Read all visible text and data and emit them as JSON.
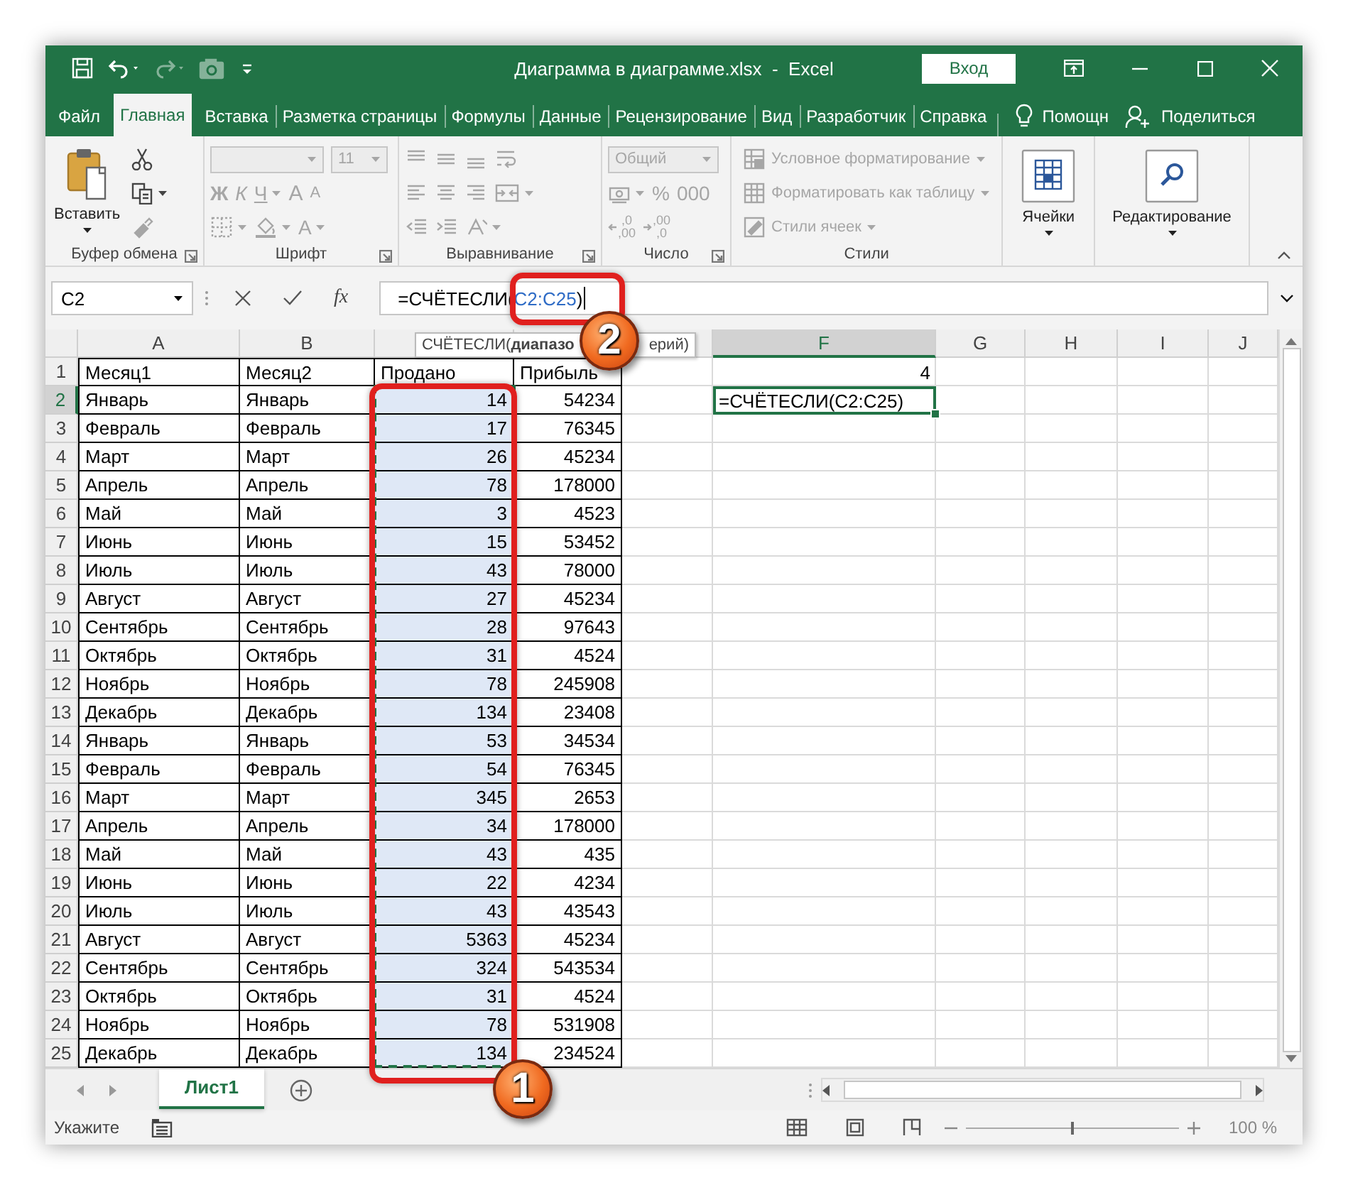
{
  "title_bar": {
    "quick_access": [
      {
        "disabled": false
      },
      {
        "disabled": false
      },
      {
        "disabled": true
      },
      {
        "disabled": true
      },
      {
        "disabled": false
      }
    ],
    "title": "Диаграмма в диаграмме.xlsx  -  Excel",
    "sign_in": "Вход"
  },
  "tabs": [
    {
      "label": "Файл",
      "selected": false
    },
    {
      "label": "Главная",
      "selected": true
    },
    {
      "label": "Вставка",
      "selected": false
    },
    {
      "label": "Разметка страницы",
      "selected": false
    },
    {
      "label": "Формулы",
      "selected": false
    },
    {
      "label": "Данные",
      "selected": false
    },
    {
      "label": "Рецензирование",
      "selected": false
    },
    {
      "label": "Вид",
      "selected": false
    },
    {
      "label": "Разработчик",
      "selected": false
    },
    {
      "label": "Справка",
      "selected": false
    }
  ],
  "help": "Помощн",
  "share": "Поделиться",
  "ribbon": {
    "groups": [
      {
        "label": "Буфер обмена",
        "launcher": true,
        "big": {
          "label": "Вставить",
          "disabled": false,
          "dropdown": true
        },
        "rows": [
          [
            {
              "kind": "icon",
              "disabled": false,
              "dropdown": false
            }
          ],
          [
            {
              "kind": "icon",
              "disabled": false,
              "dropdown": true
            }
          ],
          [
            {
              "kind": "icon",
              "disabled": true,
              "dropdown": false
            }
          ]
        ]
      },
      {
        "label": "Шрифт",
        "launcher": true,
        "rows": [
          [
            {
              "kind": "field",
              "disabled": true,
              "dropdown": true
            },
            {
              "kind": "field",
              "value": "11",
              "disabled": true,
              "dropdown": true
            }
          ],
          [
            {
              "kind": "glyph",
              "text": "Ж",
              "disabled": true,
              "dropdown": false
            },
            {
              "kind": "glyph",
              "text": "К",
              "disabled": true,
              "dropdown": false
            },
            {
              "kind": "glyph",
              "text": "Ч",
              "disabled": true,
              "dropdown": true
            },
            {
              "kind": "glyph",
              "text": "A",
              "disabled": true,
              "dropdown": false
            },
            {
              "kind": "glyph",
              "text": "A",
              "disabled": true,
              "dropdown": false
            }
          ],
          [
            {
              "kind": "icon",
              "disabled": true,
              "dropdown": true
            },
            {
              "kind": "icon",
              "disabled": true,
              "dropdown": true
            },
            {
              "kind": "glyph",
              "text": "A",
              "disabled": true,
              "dropdown": true
            }
          ]
        ]
      },
      {
        "label": "Выравнивание",
        "launcher": true,
        "rows": [
          [
            {
              "kind": "icon",
              "disabled": true,
              "dropdown": false
            },
            {
              "kind": "icon",
              "disabled": true,
              "dropdown": false
            },
            {
              "kind": "icon",
              "disabled": true,
              "dropdown": false
            },
            {
              "kind": "icon",
              "disabled": true,
              "dropdown": false
            }
          ],
          [
            {
              "kind": "icon",
              "disabled": true,
              "dropdown": false
            },
            {
              "kind": "icon",
              "disabled": true,
              "dropdown": false
            },
            {
              "kind": "icon",
              "disabled": true,
              "dropdown": false
            },
            {
              "kind": "icon",
              "disabled": true,
              "dropdown": true
            }
          ],
          [
            {
              "kind": "icon",
              "disabled": true,
              "dropdown": false
            },
            {
              "kind": "icon",
              "disabled": true,
              "dropdown": false
            },
            {
              "kind": "icon",
              "disabled": true,
              "dropdown": true
            }
          ]
        ]
      },
      {
        "label": "Число",
        "launcher": true,
        "rows": [
          [
            {
              "kind": "field",
              "value": "Общий",
              "disabled": true,
              "dropdown": true
            }
          ],
          [
            {
              "kind": "icon",
              "disabled": true,
              "dropdown": true
            },
            {
              "kind": "glyph",
              "text": "%",
              "disabled": true,
              "dropdown": false
            },
            {
              "kind": "glyph",
              "text": "000",
              "disabled": true,
              "dropdown": false
            }
          ],
          [
            {
              "kind": "decimal",
              "top": ",0",
              "bottom": ",00",
              "disabled": true
            },
            {
              "kind": "decimal",
              "top": ",00",
              "bottom": ",0",
              "disabled": true
            }
          ]
        ]
      },
      {
        "label": "Стили",
        "launcher": false,
        "rows": [
          [
            {
              "kind": "style",
              "text": "Условное форматирование",
              "disabled": true,
              "dropdown": true
            }
          ],
          [
            {
              "kind": "style",
              "text": "Форматировать как таблицу",
              "disabled": true,
              "dropdown": true
            }
          ],
          [
            {
              "kind": "style",
              "text": "Стили ячеек",
              "disabled": true,
              "dropdown": true
            }
          ]
        ]
      },
      {
        "launcher": false,
        "big": {
          "label": "Ячейки",
          "disabled": false,
          "dropdown": true
        }
      },
      {
        "launcher": false,
        "big": {
          "label": "Редактирование",
          "disabled": false,
          "dropdown": true
        }
      }
    ]
  },
  "formula_bar": {
    "name_box": "C2",
    "formula_start": "=СЧЁТЕСЛИ(",
    "formula_reference": "C2:C25",
    "formula_end": ")",
    "function_button": "fx"
  },
  "tooltip": {
    "start": "СЧЁТЕСЛИ(**диапазо**",
    "end": "ерий)"
  },
  "sheet": {
    "columns": [
      {
        "label": "A",
        "selected": false
      },
      {
        "label": "B",
        "selected": false
      },
      {
        "selected": false
      },
      {
        "selected": false
      },
      {
        "selected": false
      },
      {
        "label": "F",
        "selected": true
      },
      {
        "label": "G",
        "selected": false
      },
      {
        "label": "H",
        "selected": false
      },
      {
        "label": "I",
        "selected": false
      },
      {
        "label": "J",
        "selected": false
      }
    ],
    "rows": [
      {
        "number": "1",
        "selected": false,
        "kind": "heading",
        "range_marked": false,
        "cells": [
          "Месяц1",
          "Месяц2",
          "Продано",
          "Прибыль"
        ],
        "column_f": {
          "kind": "number",
          "text": "4",
          "active": false
        }
      },
      {
        "number": "2",
        "selected": true,
        "kind": "data",
        "range_marked": true,
        "cells": [
          "Январь",
          "Январь",
          "14",
          "54234"
        ],
        "column_f": {
          "kind": "formula",
          "text": "=СЧЁТЕСЛИ(C2:C25)",
          "active": true
        }
      },
      {
        "number": "3",
        "selected": false,
        "kind": "data",
        "range_marked": true,
        "cells": [
          "Февраль",
          "Февраль",
          "17",
          "76345"
        ]
      },
      {
        "number": "4",
        "selected": false,
        "kind": "data",
        "range_marked": true,
        "cells": [
          "Март",
          "Март",
          "26",
          "45234"
        ]
      },
      {
        "number": "5",
        "selected": false,
        "kind": "data",
        "range_marked": true,
        "cells": [
          "Апрель",
          "Апрель",
          "78",
          "178000"
        ]
      },
      {
        "number": "6",
        "selected": false,
        "kind": "data",
        "range_marked": true,
        "cells": [
          "Май",
          "Май",
          "3",
          "4523"
        ]
      },
      {
        "number": "7",
        "selected": false,
        "kind": "data",
        "range_marked": true,
        "cells": [
          "Июнь",
          "Июнь",
          "15",
          "53452"
        ]
      },
      {
        "number": "8",
        "selected": false,
        "kind": "data",
        "range_marked": true,
        "cells": [
          "Июль",
          "Июль",
          "43",
          "78000"
        ]
      },
      {
        "number": "9",
        "selected": false,
        "kind": "data",
        "range_marked": true,
        "cells": [
          "Август",
          "Август",
          "27",
          "45234"
        ]
      },
      {
        "number": "10",
        "selected": false,
        "kind": "data",
        "range_marked": true,
        "cells": [
          "Сентябрь",
          "Сентябрь",
          "28",
          "97643"
        ]
      },
      {
        "number": "11",
        "selected": false,
        "kind": "data",
        "range_marked": true,
        "cells": [
          "Октябрь",
          "Октябрь",
          "31",
          "4524"
        ]
      },
      {
        "number": "12",
        "selected": false,
        "kind": "data",
        "range_marked": true,
        "cells": [
          "Ноябрь",
          "Ноябрь",
          "78",
          "245908"
        ]
      },
      {
        "number": "13",
        "selected": false,
        "kind": "data",
        "range_marked": true,
        "cells": [
          "Декабрь",
          "Декабрь",
          "134",
          "23408"
        ]
      },
      {
        "number": "14",
        "selected": false,
        "kind": "data",
        "range_marked": true,
        "cells": [
          "Январь",
          "Январь",
          "53",
          "34534"
        ]
      },
      {
        "number": "15",
        "selected": false,
        "kind": "data",
        "range_marked": true,
        "cells": [
          "Февраль",
          "Февраль",
          "54",
          "76345"
        ]
      },
      {
        "number": "16",
        "selected": false,
        "kind": "data",
        "range_marked": true,
        "cells": [
          "Март",
          "Март",
          "345",
          "2653"
        ]
      },
      {
        "number": "17",
        "selected": false,
        "kind": "data",
        "range_marked": true,
        "cells": [
          "Апрель",
          "Апрель",
          "34",
          "178000"
        ]
      },
      {
        "number": "18",
        "selected": false,
        "kind": "data",
        "range_marked": true,
        "cells": [
          "Май",
          "Май",
          "43",
          "435"
        ]
      },
      {
        "number": "19",
        "selected": false,
        "kind": "data",
        "range_marked": true,
        "cells": [
          "Июнь",
          "Июнь",
          "22",
          "4234"
        ]
      },
      {
        "number": "20",
        "selected": false,
        "kind": "data",
        "range_marked": true,
        "cells": [
          "Июль",
          "Июль",
          "43",
          "43543"
        ]
      },
      {
        "number": "21",
        "selected": false,
        "kind": "data",
        "range_marked": true,
        "cells": [
          "Август",
          "Август",
          "5363",
          "45234"
        ]
      },
      {
        "number": "22",
        "selected": false,
        "kind": "data",
        "range_marked": true,
        "cells": [
          "Сентябрь",
          "Сентябрь",
          "324",
          "543534"
        ]
      },
      {
        "number": "23",
        "selected": false,
        "kind": "data",
        "range_marked": true,
        "cells": [
          "Октябрь",
          "Октябрь",
          "31",
          "4524"
        ]
      },
      {
        "number": "24",
        "selected": false,
        "kind": "data",
        "range_marked": true,
        "cells": [
          "Ноябрь",
          "Ноябрь",
          "78",
          "531908"
        ]
      },
      {
        "number": "25",
        "selected": false,
        "kind": "data",
        "range_marked": true,
        "cells": [
          "Декабрь",
          "Декабрь",
          "134",
          "234524"
        ]
      }
    ]
  },
  "sheet_tabs": [
    {
      "label": "Лист1",
      "selected": true
    }
  ],
  "status_bar": {
    "mode": "Укажите",
    "zoom": {
      "level": 0.5,
      "reading": "100 %"
    }
  },
  "annotations": [
    {
      "number": "1"
    },
    {
      "number": "2"
    }
  ]
}
